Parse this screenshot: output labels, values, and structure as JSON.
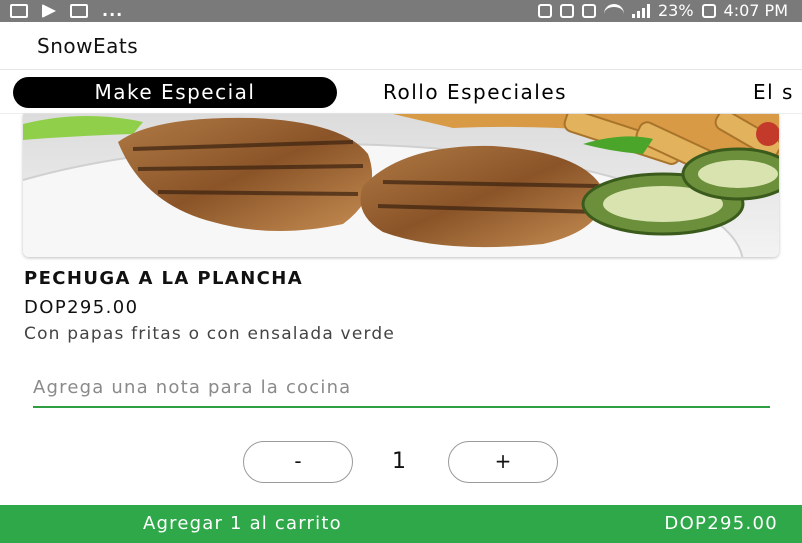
{
  "status_bar": {
    "left_more": "...",
    "battery_percent": "23%",
    "time": "4:07 PM"
  },
  "app": {
    "title": "SnowEats"
  },
  "tabs": [
    {
      "label": "Make Especial",
      "active": true
    },
    {
      "label": "Rollo Especiales",
      "active": false
    },
    {
      "label": "El s",
      "active": false
    }
  ],
  "dish": {
    "title": "PECHUGA A LA PLANCHA",
    "price": "DOP295.00",
    "description": "Con papas fritas o con ensalada verde"
  },
  "note": {
    "placeholder": "Agrega una nota para la cocina",
    "value": ""
  },
  "quantity": {
    "minus_label": "-",
    "value": "1",
    "plus_label": "+"
  },
  "cart": {
    "button_label": "Agregar 1 al carrito",
    "total": "DOP295.00"
  },
  "colors": {
    "accent_green": "#2fa84a",
    "tab_active_bg": "#000000",
    "status_bar_bg": "#7a7a7a"
  }
}
